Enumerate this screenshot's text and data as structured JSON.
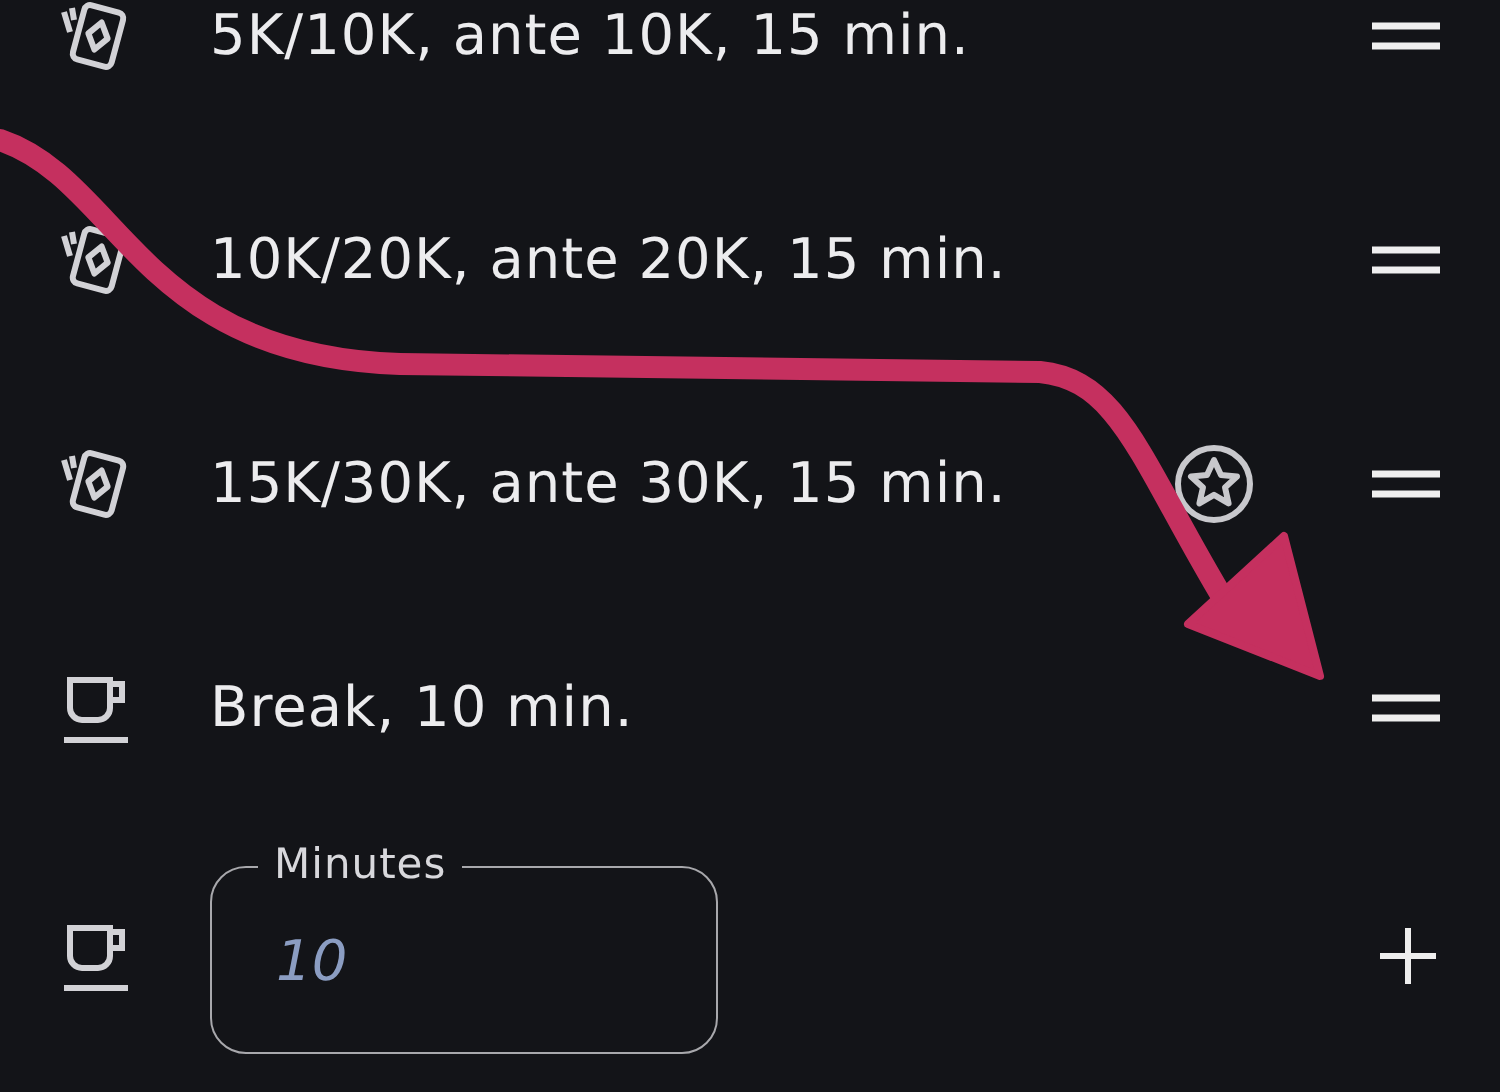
{
  "rows": [
    {
      "kind": "level",
      "text": "5K/10K, ante 10K, 15 min.",
      "starred": false
    },
    {
      "kind": "level",
      "text": "10K/20K, ante 20K, 15 min.",
      "starred": false
    },
    {
      "kind": "level",
      "text": "15K/30K, ante 30K, 15 min.",
      "starred": true
    },
    {
      "kind": "break",
      "text": "Break, 10 min.",
      "starred": false
    }
  ],
  "new_break": {
    "label": "Minutes",
    "placeholder": "10"
  }
}
